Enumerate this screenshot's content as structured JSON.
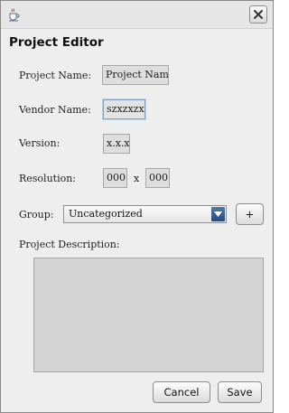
{
  "window": {
    "title": "",
    "close_icon": "close-icon",
    "app_icon": "java-cup-icon"
  },
  "dialog": {
    "heading": "Project Editor"
  },
  "form": {
    "project_name_label": "Project Name:",
    "project_name_value": "Project Name",
    "vendor_name_label": "Vendor Name:",
    "vendor_name_value": "szxzxzx",
    "version_label": "Version:",
    "version_value": "x.x.x",
    "resolution_label": "Resolution:",
    "resolution_width": "000",
    "resolution_separator": "x",
    "resolution_height": "000",
    "group_label": "Group:",
    "group_selected": "Uncategorized",
    "add_group_label": "+",
    "description_label": "Project Description:",
    "description_value": ""
  },
  "buttons": {
    "cancel_label": "Cancel",
    "save_label": "Save"
  },
  "colors": {
    "focus_border": "#7fa0c4",
    "combo_arrow": "#27497a"
  }
}
